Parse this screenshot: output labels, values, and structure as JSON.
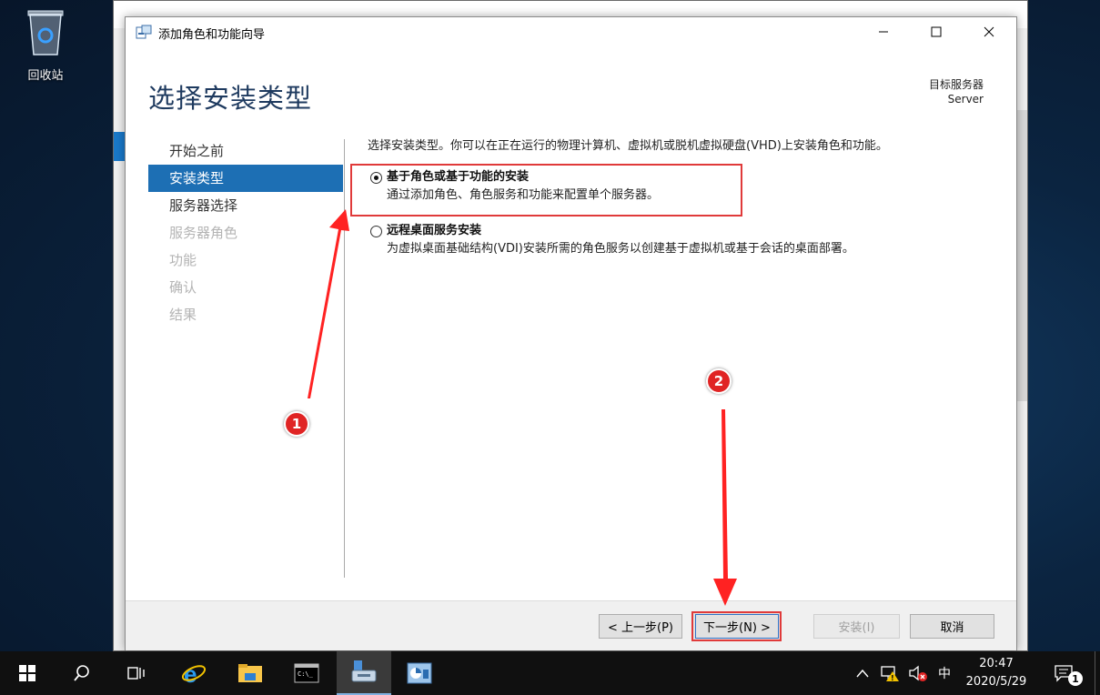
{
  "desktop": {
    "recycle_bin_label": "回收站"
  },
  "wizard": {
    "window_title": "添加角色和功能向导",
    "page_title": "选择安装类型",
    "destination_label": "目标服务器",
    "destination_server": "Server",
    "nav": [
      {
        "label": "开始之前",
        "state": "normal"
      },
      {
        "label": "安装类型",
        "state": "active"
      },
      {
        "label": "服务器选择",
        "state": "normal"
      },
      {
        "label": "服务器角色",
        "state": "disabled"
      },
      {
        "label": "功能",
        "state": "disabled"
      },
      {
        "label": "确认",
        "state": "disabled"
      },
      {
        "label": "结果",
        "state": "disabled"
      }
    ],
    "intro": "选择安装类型。你可以在正在运行的物理计算机、虚拟机或脱机虚拟硬盘(VHD)上安装角色和功能。",
    "options": [
      {
        "title": "基于角色或基于功能的安装",
        "desc": "通过添加角色、角色服务和功能来配置单个服务器。",
        "selected": true
      },
      {
        "title": "远程桌面服务安装",
        "desc": "为虚拟桌面基础结构(VDI)安装所需的角色服务以创建基于虚拟机或基于会话的桌面部署。",
        "selected": false
      }
    ],
    "buttons": {
      "prev": "< 上一步(P)",
      "next": "下一步(N) >",
      "install": "安装(I)",
      "cancel": "取消"
    }
  },
  "annotations": {
    "badge1": "1",
    "badge2": "2"
  },
  "taskbar": {
    "ime": "中",
    "time": "20:47",
    "date": "2020/5/29",
    "notification_count": "1"
  },
  "colors": {
    "accent": "#1d6fb4",
    "highlight_red": "#e03a3a",
    "badge_red": "#e02424"
  }
}
